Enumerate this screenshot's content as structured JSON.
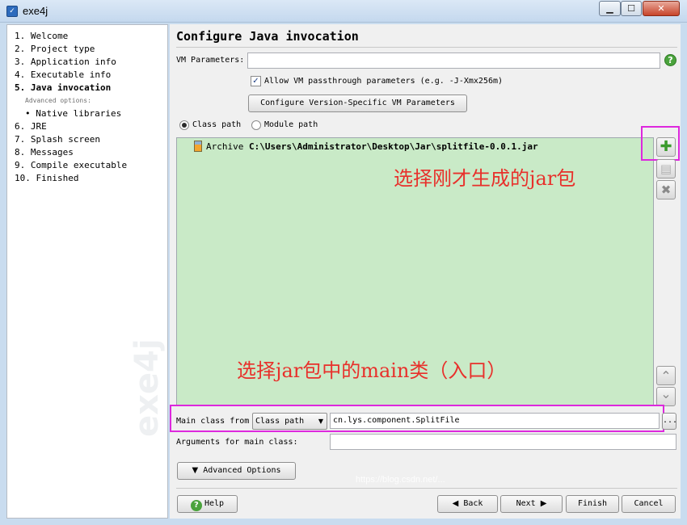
{
  "window": {
    "title": "exe4j",
    "minimize_glyph": "▁",
    "maximize_glyph": "☐",
    "close_glyph": "✕"
  },
  "steps": [
    {
      "label": "1. Welcome"
    },
    {
      "label": "2. Project type"
    },
    {
      "label": "3. Application info"
    },
    {
      "label": "4. Executable info"
    },
    {
      "label": "5. Java invocation",
      "active": true
    },
    {
      "label": "Advanced options:"
    },
    {
      "label": "• Native libraries"
    },
    {
      "label": "6. JRE"
    },
    {
      "label": "7. Splash screen"
    },
    {
      "label": "8. Messages"
    },
    {
      "label": "9. Compile executable"
    },
    {
      "label": "10. Finished"
    }
  ],
  "sidebar_watermark": "exe4j",
  "page": {
    "title": "Configure Java invocation",
    "vm_params_label": "VM Parameters:",
    "vm_params_value": "",
    "help_glyph": "?",
    "passthrough_label": "Allow VM passthrough parameters (e.g. -J-Xmx256m)",
    "passthrough_checked": true,
    "version_vm_button": "Configure Version-Specific VM Parameters",
    "classpath_radio": "Class path",
    "modulepath_radio": "Module path",
    "selected_path_mode": "Class path"
  },
  "classpath": {
    "entries": [
      {
        "type": "Archive",
        "path": "C:\\Users\\Administrator\\Desktop\\Jar\\splitfile-0.0.1.jar"
      }
    ],
    "add_glyph": "✚",
    "edit_glyph": "▤",
    "remove_glyph": "✖",
    "up_glyph": "⌃",
    "down_glyph": "⌄"
  },
  "annotations": {
    "select_jar": "选择刚才生成的jar包",
    "select_main": "选择jar包中的main类（入口）"
  },
  "main_class": {
    "label": "Main class from",
    "source": "Class path",
    "value": "cn.lys.component.SplitFile",
    "browse_label": "..."
  },
  "arguments": {
    "label": "Arguments for main class:",
    "value": ""
  },
  "advanced_button": "Advanced Options",
  "nav": {
    "help": "Help",
    "back": "Back",
    "next": "Next",
    "finish": "Finish",
    "cancel": "Cancel"
  },
  "url_watermark": "https://blog.csdn.net/...",
  "colors": {
    "list_bg": "#c9eac7",
    "highlight": "#dd28dd",
    "annotation": "#e8302b",
    "add_green": "#3a9b2c"
  }
}
